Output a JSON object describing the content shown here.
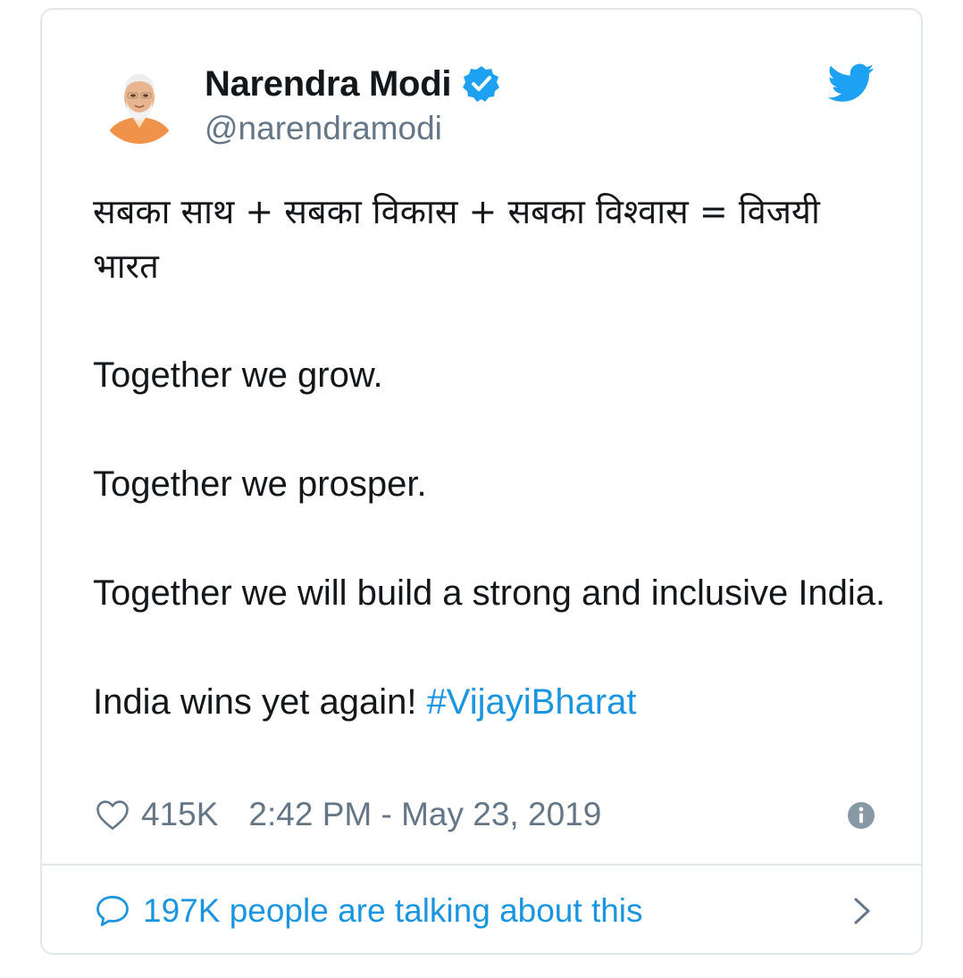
{
  "author": {
    "display_name": "Narendra Modi",
    "handle": "@narendramodi",
    "verified": true,
    "avatar": "avatar"
  },
  "tweet": {
    "hindi_line_1": "सबका साथ + सबका विकास + सबका विश्वास = विजयी",
    "hindi_line_2": "भारत",
    "line_1": "Together we grow.",
    "line_2": "Together we prosper.",
    "line_3": "Together we will build a strong and inclusive India.",
    "line_4_text": "India wins yet again! ",
    "hashtag": "#VijayiBharat"
  },
  "meta": {
    "like_count": "415K",
    "timestamp": "2:42 PM - May 23, 2019"
  },
  "footer": {
    "talking_label": "197K people are talking about this"
  },
  "icons": {
    "brand": "twitter-bird-icon",
    "verified": "verified-badge-icon",
    "like": "heart-icon",
    "info": "info-icon",
    "reply": "speech-bubble-icon",
    "more": "chevron-right-icon"
  },
  "colors": {
    "accent": "#1da1f2",
    "link": "#1b95e0",
    "text": "#14171a",
    "secondary": "#657786",
    "border": "#e1e8ed"
  }
}
